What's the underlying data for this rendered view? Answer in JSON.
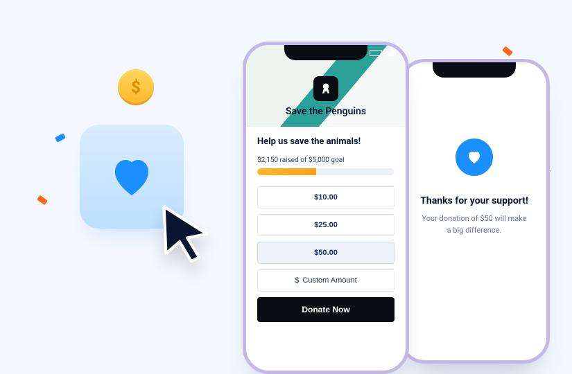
{
  "illustration": {
    "coin_symbol": "$"
  },
  "donation_form": {
    "org_name": "Save the Penguins",
    "headline": "Help us save the animals!",
    "progress_text": "$2,150 raised of $5,000 goal",
    "progress_percent": 43,
    "amounts": [
      {
        "label": "$10.00",
        "selected": false
      },
      {
        "label": "$25.00",
        "selected": false
      },
      {
        "label": "$50.00",
        "selected": true
      }
    ],
    "custom_label": "Custom Amount",
    "custom_prefix": "$",
    "submit_label": "Donate Now"
  },
  "thank_you": {
    "title": "Thanks for your support!",
    "message": "Your donation of $50 will make a big difference."
  }
}
